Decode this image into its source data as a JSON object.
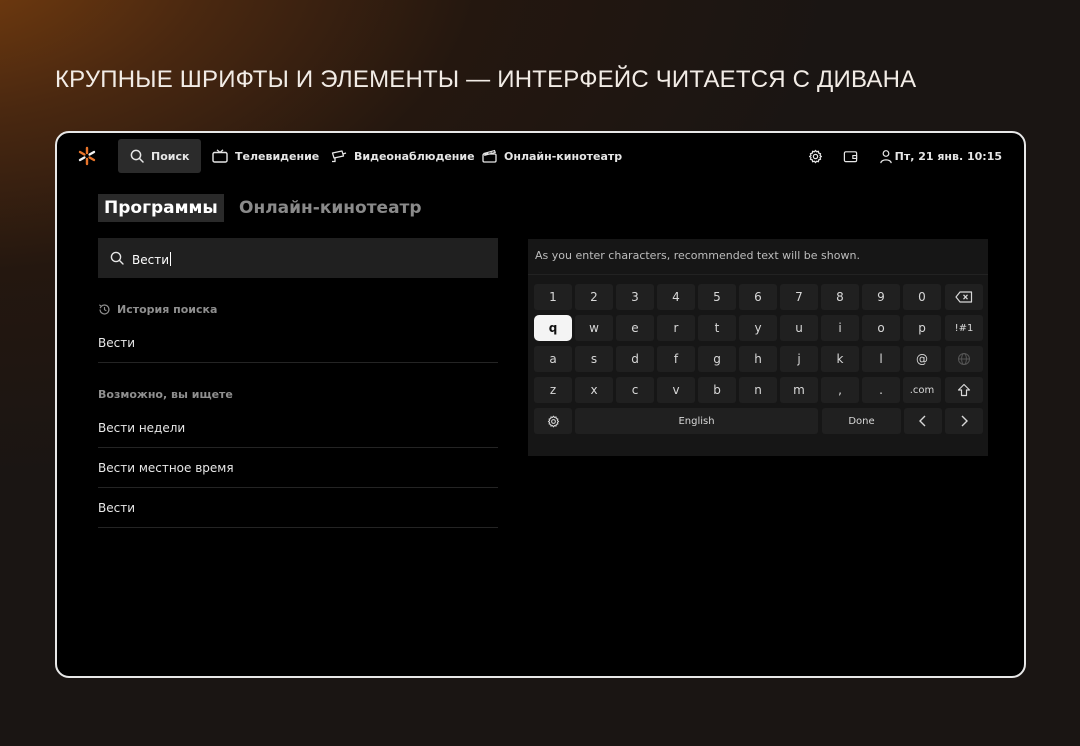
{
  "headline": "КРУПНЫЕ ШРИФТЫ И ЭЛЕМЕНТЫ — ИНТЕРФЕЙС ЧИТАЕТСЯ С ДИВАНА",
  "nav": {
    "search": "Поиск",
    "tv": "Телевидение",
    "cctv": "Видеонаблюдение",
    "cinema": "Онлайн-кинотеатр",
    "datetime": "Пт, 21 янв. 10:15"
  },
  "tabs": {
    "programs": "Программы",
    "cinema": "Онлайн-кинотеатр"
  },
  "search": {
    "value": "Вести"
  },
  "history": {
    "label": "История поиска",
    "items": [
      "Вести"
    ]
  },
  "suggestions": {
    "label": "Возможно, вы ищете",
    "items": [
      "Вести недели",
      "Вести местное время",
      "Вести"
    ]
  },
  "keyboard": {
    "hint": "As you enter characters, recommended text will be shown.",
    "rows": [
      [
        "1",
        "2",
        "3",
        "4",
        "5",
        "6",
        "7",
        "8",
        "9",
        "0"
      ],
      [
        "q",
        "w",
        "e",
        "r",
        "t",
        "y",
        "u",
        "i",
        "o",
        "p"
      ],
      [
        "a",
        "s",
        "d",
        "f",
        "g",
        "h",
        "j",
        "k",
        "l",
        "@"
      ],
      [
        "z",
        "x",
        "c",
        "v",
        "b",
        "n",
        "m",
        ",",
        ".",
        ".com"
      ]
    ],
    "symbols": "!#1",
    "language": "English",
    "done": "Done",
    "focused_key": "q"
  },
  "colors": {
    "accent": "#e8742a",
    "focus": "#f4f4f4"
  }
}
